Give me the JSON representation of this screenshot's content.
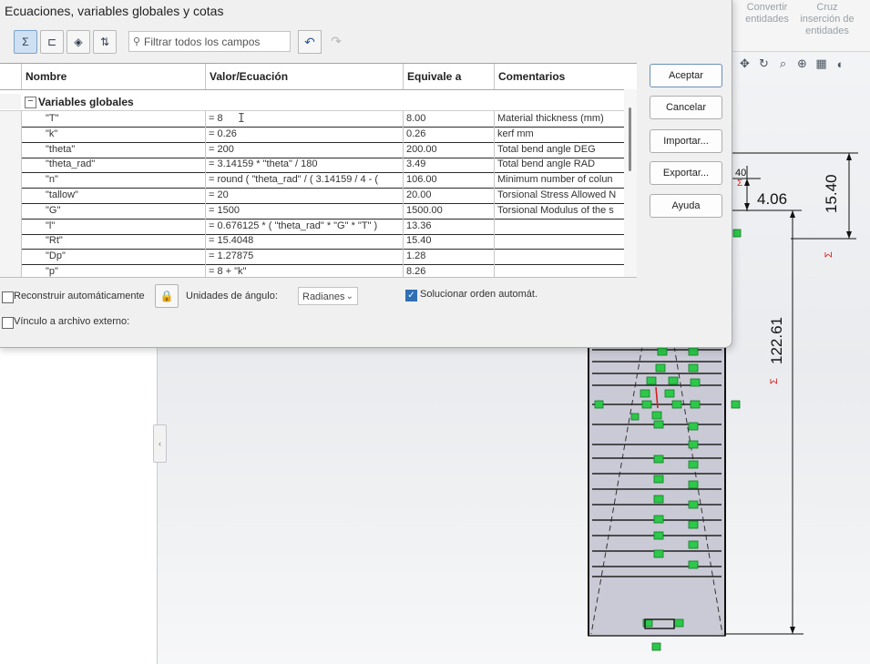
{
  "dialog": {
    "title": "Ecuaciones, variables globales y cotas",
    "filter_placeholder": "Filtrar todos los campos",
    "columns": [
      "Nombre",
      "Valor/Ecuación",
      "Equivale a",
      "Comentarios"
    ],
    "group_label": "Variables globales",
    "rows": [
      {
        "name": "\"T\"",
        "value": "= 8",
        "equals": "8.00",
        "comment": "Material thickness (mm)"
      },
      {
        "name": "\"k\"",
        "value": "= 0.26",
        "equals": "0.26",
        "comment": "kerf mm"
      },
      {
        "name": "\"theta\"",
        "value": "= 200",
        "equals": "200.00",
        "comment": "Total bend angle DEG"
      },
      {
        "name": "\"theta_rad\"",
        "value": "= 3.14159 * \"theta\" / 180",
        "equals": "3.49",
        "comment": "Total bend angle RAD"
      },
      {
        "name": "\"n\"",
        "value": "= round ( \"theta_rad\" / ( 3.14159 / 4 - (",
        "equals": "106.00",
        "comment": "Minimum number of colun"
      },
      {
        "name": "\"tallow\"",
        "value": "= 20",
        "equals": "20.00",
        "comment": "Torsional Stress Allowed N"
      },
      {
        "name": "\"G\"",
        "value": "= 1500",
        "equals": "1500.00",
        "comment": "Torsional Modulus of the s"
      },
      {
        "name": "\"l\"",
        "value": "= 0.676125 * ( \"theta_rad\" * \"G\" * \"T\" )",
        "equals": "13.36",
        "comment": ""
      },
      {
        "name": "\"Rt\"",
        "value": "= 15.4048",
        "equals": "15.40",
        "comment": ""
      },
      {
        "name": "\"Dp\"",
        "value": "= 1.27875",
        "equals": "1.28",
        "comment": ""
      },
      {
        "name": "\"p\"",
        "value": "= 8 + \"k\"",
        "equals": "8.26",
        "comment": ""
      }
    ],
    "buttons": {
      "accept": "Aceptar",
      "cancel": "Cancelar",
      "import": "Importar...",
      "export": "Exportar...",
      "help": "Ayuda"
    },
    "options": {
      "auto_rebuild": "Reconstruir automáticamente",
      "angle_units_label": "Unidades de ángulo:",
      "angle_units_value": "Radianes",
      "auto_solve": "Solucionar orden automát.",
      "external_link": "Vínculo a archivo externo:"
    }
  },
  "cad": {
    "toolbar": {
      "cmd1": "Convertir entidades",
      "cmd2": "Cruz inserción de entidades"
    },
    "dimensions": {
      "d1": "4.06",
      "d2": "15.40",
      "d3": "122.61",
      "d4": "40"
    }
  }
}
